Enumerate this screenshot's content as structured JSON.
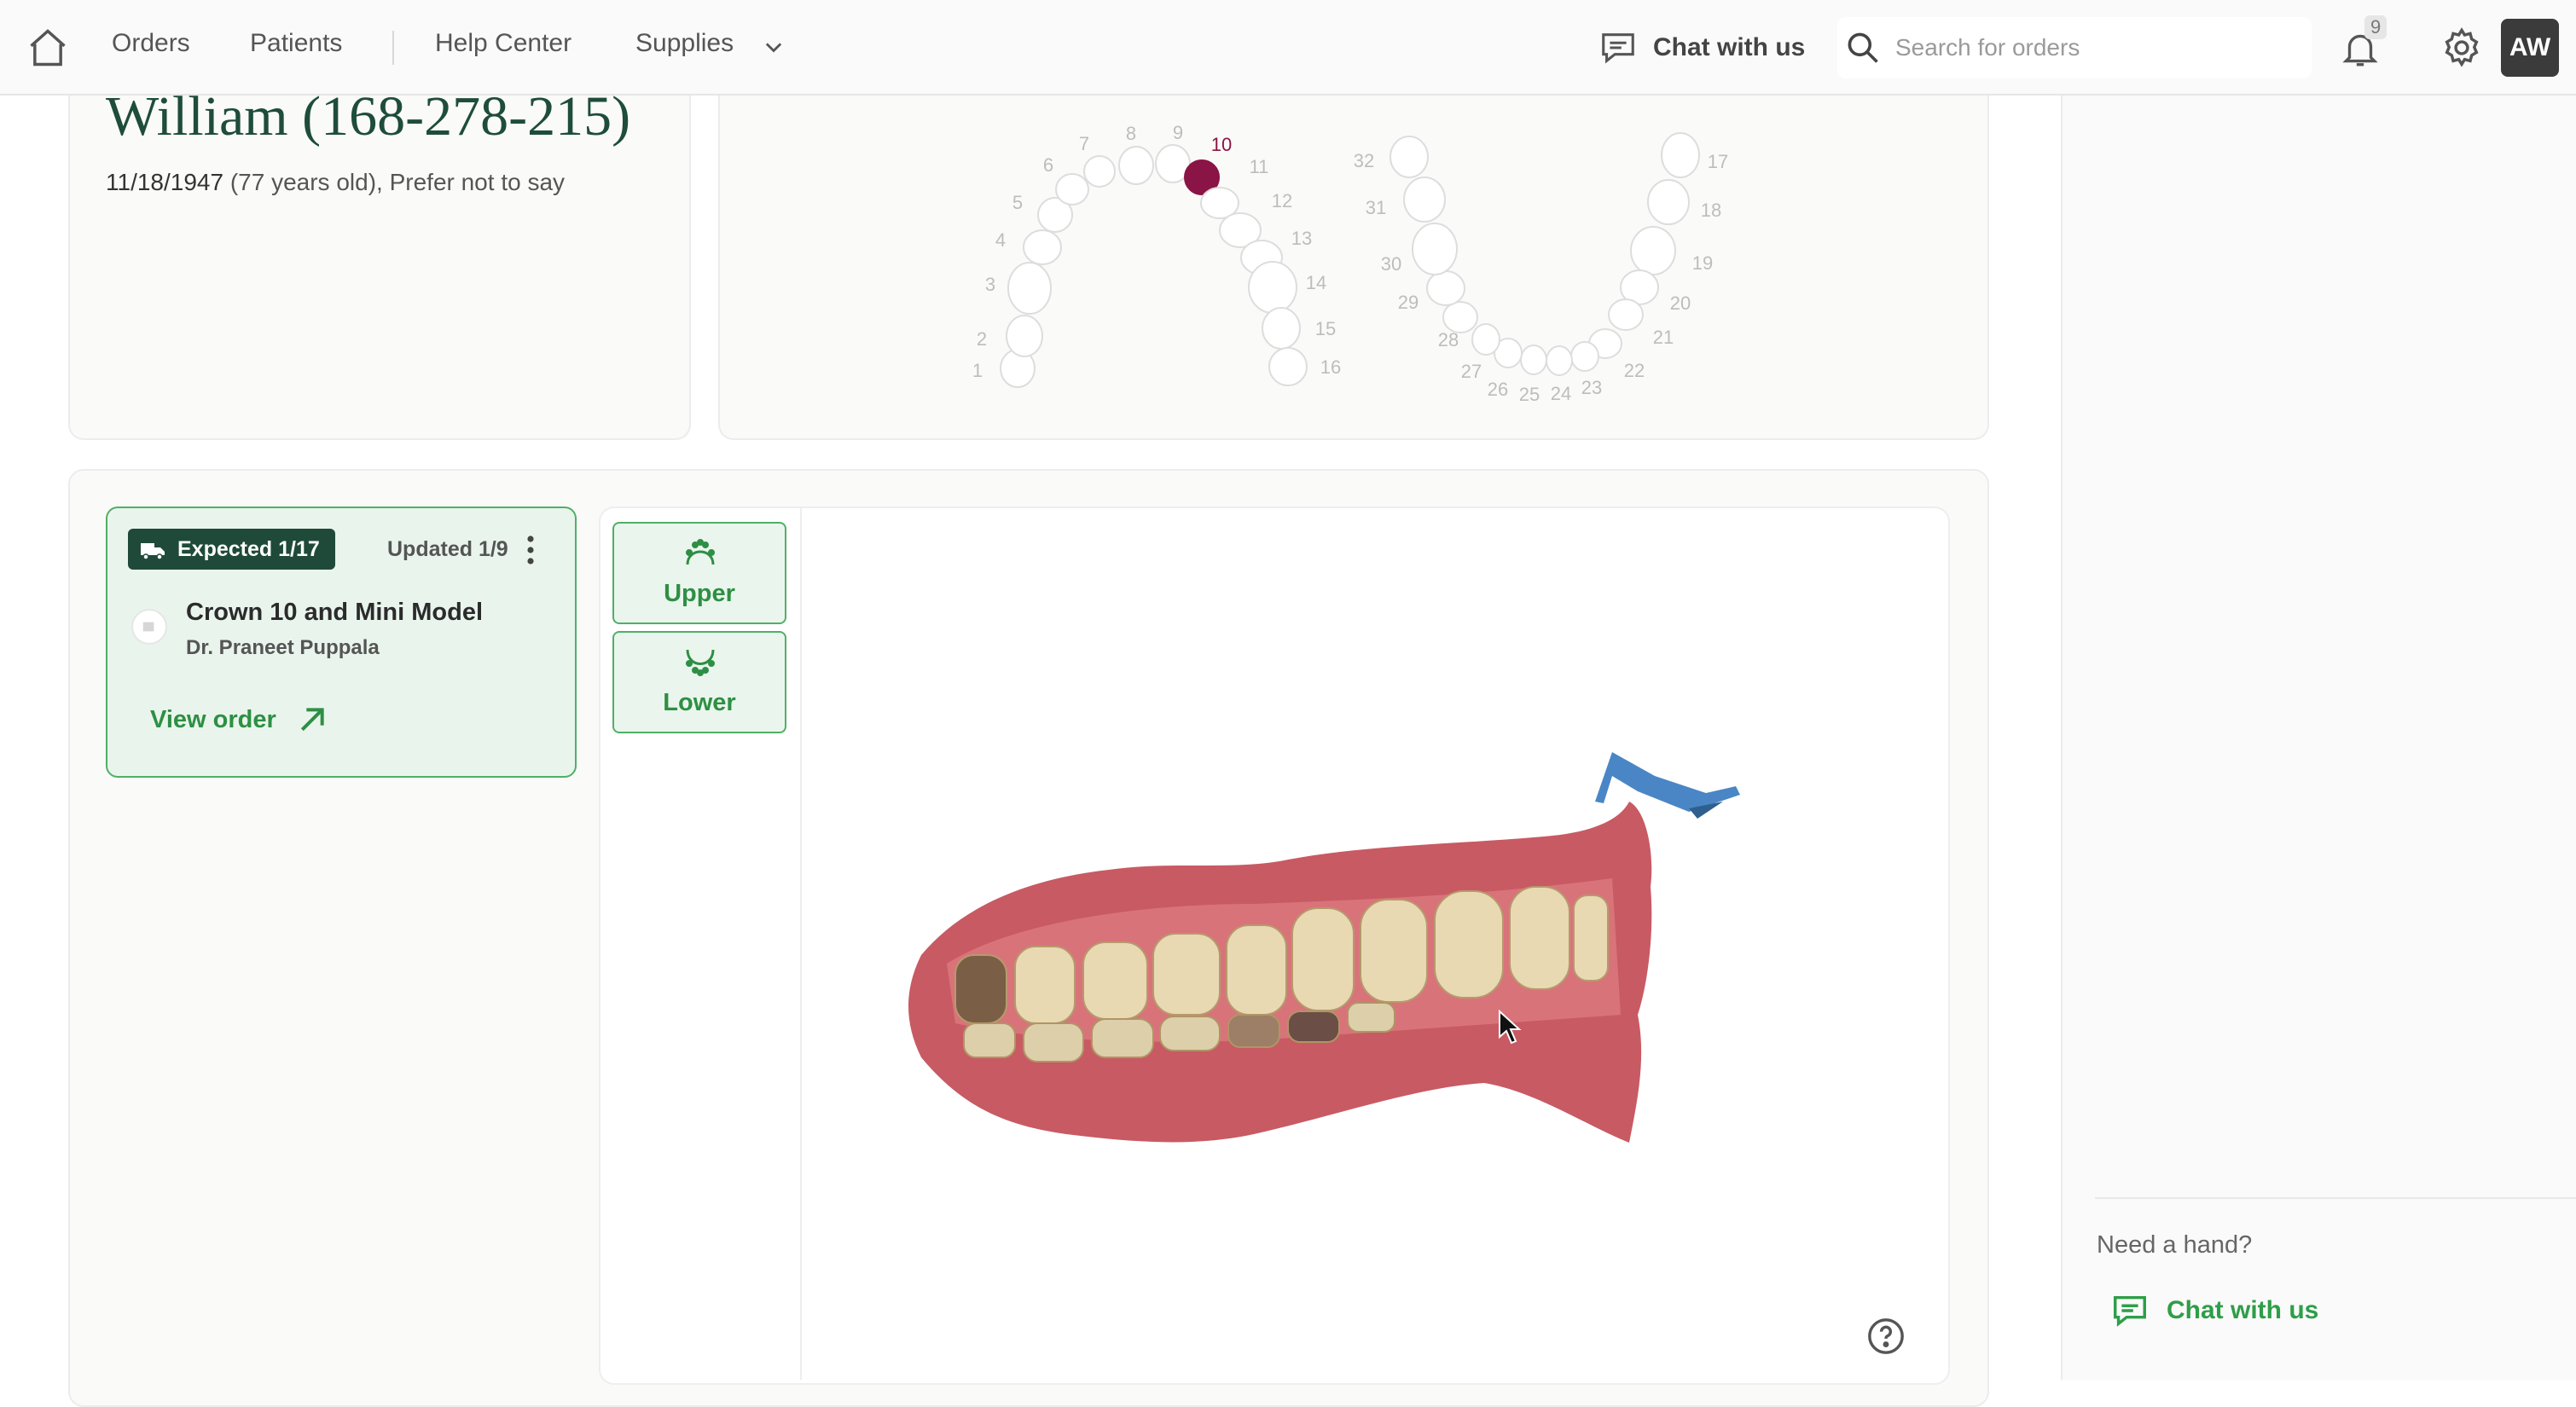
{
  "nav": {
    "home_icon": "home-icon",
    "orders": "Orders",
    "patients": "Patients",
    "help_center": "Help Center",
    "supplies": "Supplies",
    "chat": "Chat with us",
    "search_placeholder": "Search for orders",
    "notification_count": "9",
    "avatar_initials": "AW"
  },
  "patient": {
    "name": "William (168-278-215)",
    "dob": "11/18/1947",
    "details": " (77 years old), Prefer not to say"
  },
  "tooth_chart": {
    "upper_numbers": [
      "1",
      "2",
      "3",
      "4",
      "5",
      "6",
      "7",
      "8",
      "9",
      "10",
      "11",
      "12",
      "13",
      "14",
      "15",
      "16"
    ],
    "lower_numbers": [
      "17",
      "18",
      "19",
      "20",
      "21",
      "22",
      "23",
      "24",
      "25",
      "26",
      "27",
      "28",
      "29",
      "30",
      "31",
      "32"
    ],
    "selected_tooth": "10",
    "selected_color": "#8a1445"
  },
  "order": {
    "expected": "Expected 1/17",
    "updated": "Updated 1/9",
    "title": "Crown 10 and Mini Model",
    "doctor": "Dr. Praneet Puppala",
    "view_order": "View order"
  },
  "viewer": {
    "upper_label": "Upper",
    "lower_label": "Lower"
  },
  "side_panel": {
    "need_hand": "Need a hand?",
    "chat": "Chat with us"
  },
  "colors": {
    "accent_green": "#2e8f44",
    "badge_dark": "#1f4a3a",
    "order_card_bg": "#e9f5ec"
  }
}
